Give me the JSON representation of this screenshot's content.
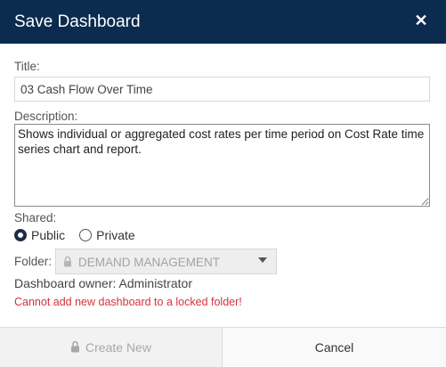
{
  "dialog": {
    "title": "Save Dashboard",
    "close_icon": "close-icon"
  },
  "form": {
    "title_label": "Title:",
    "title_value": "03 Cash Flow Over Time",
    "description_label": "Description:",
    "description_value": "Shows individual or aggregated cost rates per time period on Cost Rate time series chart and report.",
    "shared_label": "Shared:",
    "shared_options": [
      {
        "label": "Public",
        "selected": true
      },
      {
        "label": "Private",
        "selected": false
      }
    ],
    "folder_label": "Folder:",
    "folder_value": "DEMAND MANAGEMENT",
    "folder_icon": "lock-icon",
    "owner_text": "Dashboard owner: Administrator",
    "error_text": "Cannot add new dashboard to a locked folder!"
  },
  "footer": {
    "create_label": "Create New",
    "create_icon": "lock-icon",
    "cancel_label": "Cancel"
  },
  "colors": {
    "header_bg": "#0b2b4f",
    "error": "#d9303c"
  }
}
